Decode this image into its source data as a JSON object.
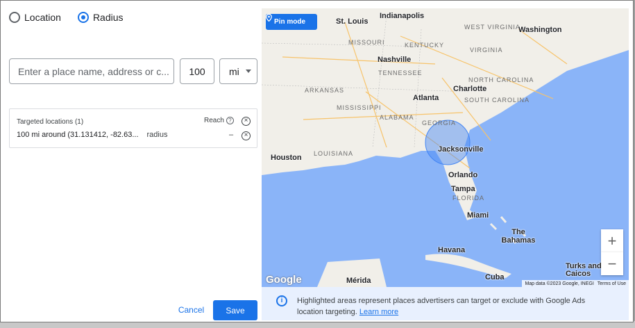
{
  "targeting": {
    "option_location": "Location",
    "option_radius": "Radius",
    "selected": "Radius",
    "place_placeholder": "Enter a place name, address or c...",
    "distance_value": "100",
    "unit_value": "mi"
  },
  "targeted": {
    "header": "Targeted locations (1)",
    "reach_label": "Reach",
    "item_text": "100 mi around (31.131412, -82.63...",
    "item_sub": "radius",
    "item_reach": "–"
  },
  "map": {
    "pin_mode_label": "Pin mode",
    "zoom_in": "+",
    "zoom_out": "−",
    "google_logo": "Google",
    "attribution": "Map data ©2023 Google, INEGI",
    "terms": "Terms of Use",
    "labels": {
      "indianapolis": "Indianapolis",
      "st_louis": "St. Louis",
      "west_virginia": "WEST VIRGINIA",
      "washington": "Washington",
      "missouri": "MISSOURI",
      "kentucky": "KENTUCKY",
      "virginia": "VIRGINIA",
      "nashville": "Nashville",
      "tennessee": "TENNESSEE",
      "north_carolina": "NORTH CAROLINA",
      "arkansas": "ARKANSAS",
      "charlotte": "Charlotte",
      "atlanta": "Atlanta",
      "south_carolina": "SOUTH CAROLINA",
      "mississippi": "MISSISSIPPI",
      "alabama": "ALABAMA",
      "georgia": "GEORGIA",
      "jacksonville": "Jacksonville",
      "houston": "Houston",
      "louisiana": "LOUISIANA",
      "orlando": "Orlando",
      "tampa": "Tampa",
      "florida": "FLORIDA",
      "miami": "Miami",
      "the_bahamas": "The Bahamas",
      "havana": "Havana",
      "turks_caicos": "Turks and Caicos",
      "merida": "Mérida",
      "cuba": "Cuba"
    }
  },
  "info": {
    "text": "Highlighted areas represent places advertisers can target or exclude with Google Ads location targeting.",
    "link": "Learn more"
  },
  "actions": {
    "cancel": "Cancel",
    "save": "Save"
  },
  "colors": {
    "accent": "#1a73e8",
    "water": "#8ab4f8",
    "land": "#f1efe9",
    "radius_fill": "#4285f4"
  }
}
